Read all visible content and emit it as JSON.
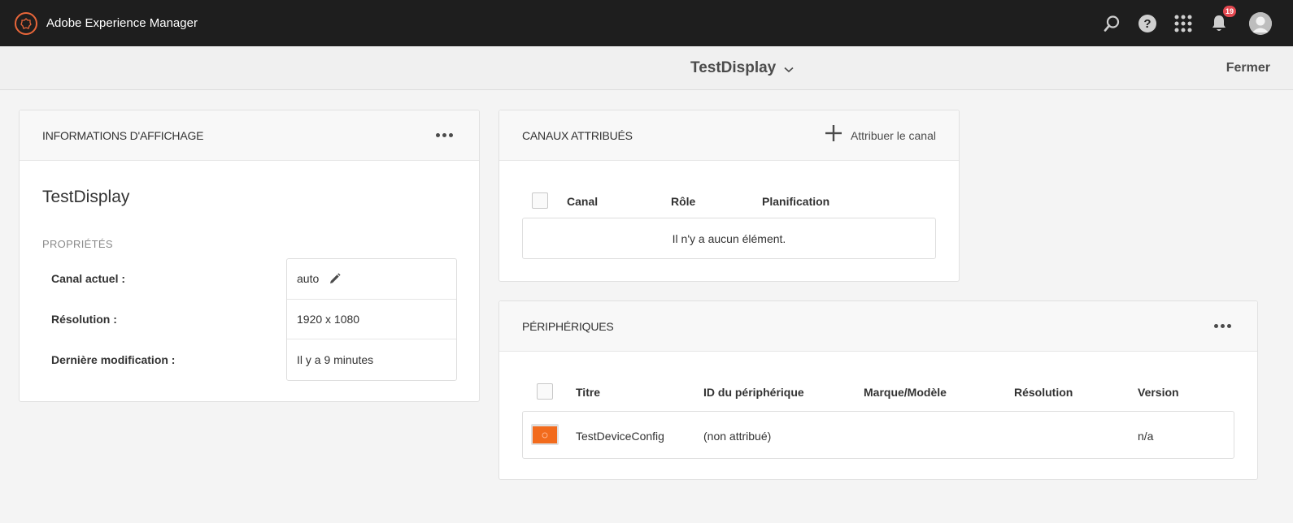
{
  "app": {
    "name": "Adobe Experience Manager",
    "notification_count": "19"
  },
  "icons": {
    "logo": "aem-logo-icon",
    "search": "search-icon",
    "help": "help-icon",
    "apps": "grid-icon",
    "notifications": "bell-icon",
    "user": "avatar-icon"
  },
  "header": {
    "title": "TestDisplay",
    "close_label": "Fermer"
  },
  "info_card": {
    "title": "INFORMATIONS D'AFFICHAGE",
    "name": "TestDisplay",
    "properties_label": "PROPRIÉTÉS",
    "properties": [
      {
        "label": "Canal actuel :",
        "value": "auto"
      },
      {
        "label": "Résolution :",
        "value": "1920 x 1080"
      },
      {
        "label": "Dernière modification :",
        "value": "Il y a 9 minutes"
      }
    ]
  },
  "channels_card": {
    "title": "CANAUX ATTRIBUÉS",
    "assign_label": "Attribuer le canal",
    "columns": [
      "Canal",
      "Rôle",
      "Planification"
    ],
    "empty_message": "Il n'y a aucun élément."
  },
  "devices_card": {
    "title": "PÉRIPHÉRIQUES",
    "columns": [
      "Titre",
      "ID du périphérique",
      "Marque/Modèle",
      "Résolution",
      "Version"
    ],
    "rows": [
      {
        "title": "TestDeviceConfig",
        "device_id": "(non attribué)",
        "model": "",
        "resolution": "",
        "version": "n/a"
      }
    ]
  },
  "colors": {
    "topbar_bg": "#1e1e1e",
    "accent_orange": "#f26b1d",
    "badge_red": "#e34850",
    "page_bg": "#f4f4f4"
  }
}
